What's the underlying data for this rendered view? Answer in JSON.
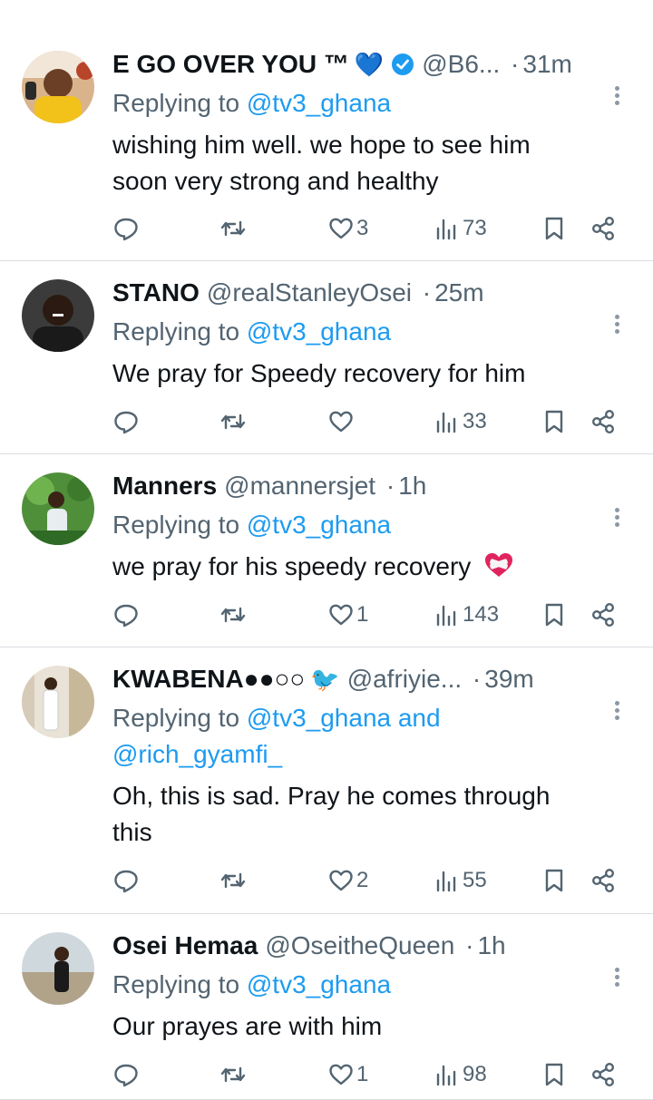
{
  "replies": [
    {
      "name": "E GO OVER YOU ™",
      "name_emoji": "💙",
      "verified": true,
      "handle": "@B6...",
      "time": "31m",
      "replying_prefix": "Replying to",
      "replying_to": "@tv3_ghana",
      "text_lines": [
        "wishing him well. we hope to see him",
        "soon very strong and healthy"
      ],
      "likes": "3",
      "views": "73"
    },
    {
      "name": "STANO",
      "handle": "@realStanleyOsei",
      "time": "25m",
      "replying_prefix": "Replying to",
      "replying_to": "@tv3_ghana",
      "text_lines": [
        "We pray for Speedy recovery for him"
      ],
      "likes": "",
      "views": "33"
    },
    {
      "name": "Manners",
      "handle": "@mannersjet",
      "time": "1h",
      "replying_prefix": "Replying to",
      "replying_to": "@tv3_ghana",
      "text_lines": [
        "we pray for his speedy recovery"
      ],
      "text_emoji": "❤️‍🩹",
      "likes": "1",
      "views": "143"
    },
    {
      "name": "KWABENA●●○○",
      "name_emoji": "🐦",
      "handle": "@afriyie...",
      "time": "39m",
      "replying_prefix": "Replying to",
      "replying_to": "@tv3_ghana and",
      "replying_to_2": "@rich_gyamfi_",
      "text_lines": [
        "Oh, this is sad. Pray he comes through",
        "this"
      ],
      "likes": "2",
      "views": "55"
    },
    {
      "name": "Osei Hemaa",
      "handle": "@OseitheQueen",
      "time": "1h",
      "replying_prefix": "Replying to",
      "replying_to": "@tv3_ghana",
      "text_lines": [
        "Our prayes are with him"
      ],
      "likes": "1",
      "views": "98"
    }
  ],
  "icons": {
    "reply": "reply-icon",
    "retweet": "retweet-icon",
    "like": "heart-icon",
    "views": "views-icon",
    "bookmark": "bookmark-icon",
    "share": "share-icon",
    "more": "more-icon",
    "verified": "verified-badge-icon"
  },
  "colors": {
    "text": "#0f1419",
    "muted": "#536471",
    "link": "#1d9bf0",
    "divider": "#dadde1",
    "verified": "#1d9bf0"
  }
}
